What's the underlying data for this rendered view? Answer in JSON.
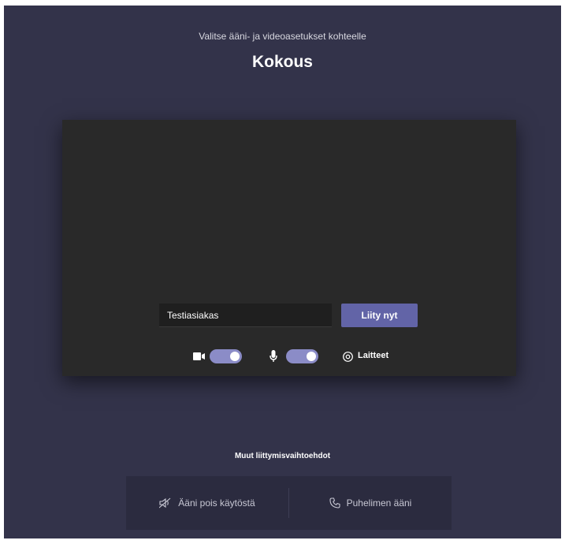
{
  "header": {
    "subtitle": "Valitse ääni- ja videoasetukset kohteelle",
    "title": "Kokous"
  },
  "preview": {
    "name_value": "Testiasiakas",
    "join_label": "Liity nyt",
    "camera_on": true,
    "mic_on": true,
    "devices_label": "Laitteet"
  },
  "other_options": {
    "title": "Muut liittymisvaihtoehdot",
    "audio_off_label": "Ääni pois käytöstä",
    "phone_audio_label": "Puhelimen ääni"
  },
  "colors": {
    "background": "#33334a",
    "preview": "#292929",
    "accent": "#6264a7",
    "toggle": "#8b8cc7"
  }
}
